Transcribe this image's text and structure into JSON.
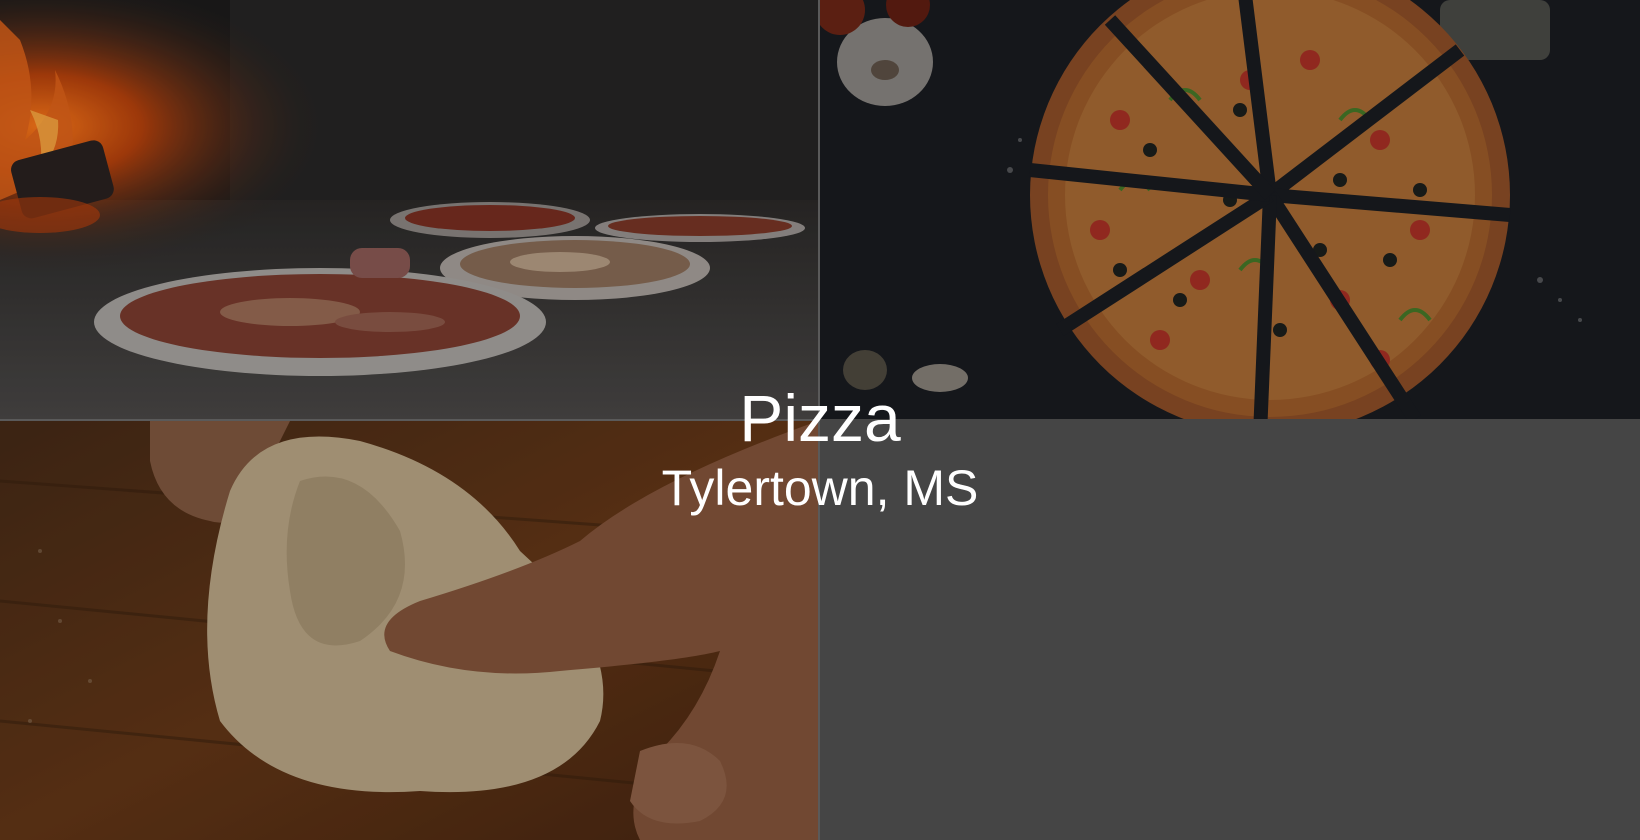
{
  "hero": {
    "title": "Pizza",
    "location": "Tylertown, MS"
  },
  "photos": [
    {
      "subject": "pizzas-in-wood-fired-oven"
    },
    {
      "subject": "sliced-pizza-top-view"
    },
    {
      "subject": "hands-kneading-dough"
    }
  ],
  "colors": {
    "background": "#454545",
    "text": "#ffffff",
    "overlay": "#000000"
  }
}
